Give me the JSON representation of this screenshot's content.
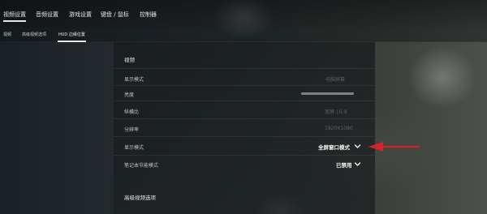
{
  "nav": {
    "tabs": [
      {
        "label": "视频设置"
      },
      {
        "label": "音频设置"
      },
      {
        "label": "游戏设置"
      },
      {
        "label": "键盘 / 鼠标"
      },
      {
        "label": "控制器"
      }
    ],
    "active_tab": 0
  },
  "subnav": {
    "tabs": [
      {
        "label": "视频"
      },
      {
        "label": "高级视频选项"
      },
      {
        "label": "HUD 边缘位置"
      }
    ],
    "active_tab": 2
  },
  "video": {
    "section_title": "视频",
    "rows": {
      "display_mode_top": {
        "label": "显示模式",
        "value": "电脑屏幕"
      },
      "brightness": {
        "label": "亮度",
        "level": 1.0
      },
      "aspect_ratio": {
        "label": "纵横比",
        "value": "宽屏 16:9"
      },
      "resolution": {
        "label": "分辨率",
        "value": "1920X1080"
      },
      "display_mode": {
        "label": "显示模式",
        "value": "全屏窗口模式"
      },
      "laptop_power_saving": {
        "label": "笔记本节能模式",
        "value": "已禁用"
      }
    }
  },
  "advanced": {
    "section_title": "高级视频选项"
  },
  "annotation": {
    "arrow_color": "#d6222a"
  },
  "colors": {
    "accent": "#e8e8e8",
    "panel": "#1a1e21"
  }
}
